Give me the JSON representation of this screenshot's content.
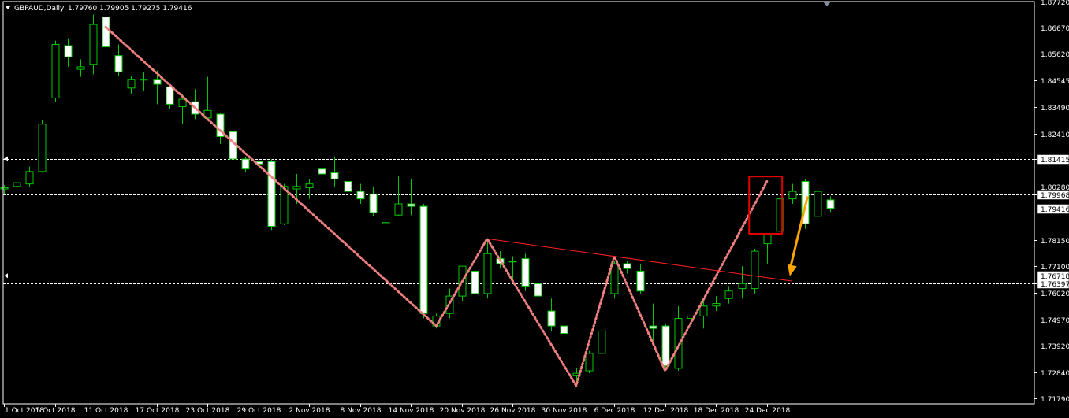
{
  "header": {
    "symbol": "GBPAUD,Daily",
    "ohlc": "1.79760 1.79905 1.79275 1.79416"
  },
  "chart_data": {
    "type": "candlestick",
    "title": "GBPAUD,Daily",
    "ylim": [
      1.717,
      1.8772
    ],
    "y_ticks": [
      "1.87720",
      "1.86670",
      "1.85620",
      "1.84545",
      "1.83490",
      "1.82410",
      "1.81415",
      "1.80280",
      "1.79968",
      "1.79416",
      "1.78150",
      "1.77100",
      "1.76718",
      "1.76397",
      "1.76020",
      "1.74970",
      "1.73920",
      "1.72840",
      "1.71790"
    ],
    "x_ticks": [
      {
        "i": 0,
        "label": "1 Oct 2018"
      },
      {
        "i": 4,
        "label": "5 Oct 2018"
      },
      {
        "i": 8,
        "label": "11 Oct 2018"
      },
      {
        "i": 12,
        "label": "17 Oct 2018"
      },
      {
        "i": 16,
        "label": "23 Oct 2018"
      },
      {
        "i": 20,
        "label": "29 Oct 2018"
      },
      {
        "i": 24,
        "label": "2 Nov 2018"
      },
      {
        "i": 28,
        "label": "8 Nov 2018"
      },
      {
        "i": 32,
        "label": "14 Nov 2018"
      },
      {
        "i": 36,
        "label": "20 Nov 2018"
      },
      {
        "i": 40,
        "label": "26 Nov 2018"
      },
      {
        "i": 44,
        "label": "30 Nov 2018"
      },
      {
        "i": 48,
        "label": "6 Dec 2018"
      },
      {
        "i": 52,
        "label": "12 Dec 2018"
      },
      {
        "i": 56,
        "label": "18 Dec 2018"
      },
      {
        "i": 60,
        "label": "24 Dec 2018"
      }
    ],
    "candles": [
      [
        1.802,
        1.8035,
        1.8,
        1.8025
      ],
      [
        1.803,
        1.806,
        1.801,
        1.8045
      ],
      [
        1.804,
        1.811,
        1.803,
        1.809
      ],
      [
        1.809,
        1.8295,
        1.8085,
        1.828
      ],
      [
        1.8385,
        1.8615,
        1.837,
        1.86
      ],
      [
        1.8595,
        1.8625,
        1.851,
        1.855
      ],
      [
        1.85,
        1.854,
        1.847,
        1.851
      ],
      [
        1.852,
        1.872,
        1.848,
        1.868
      ],
      [
        1.871,
        1.873,
        1.857,
        1.859
      ],
      [
        1.8555,
        1.86,
        1.8475,
        1.849
      ],
      [
        1.8425,
        1.8475,
        1.84,
        1.846
      ],
      [
        1.846,
        1.849,
        1.8415,
        1.846
      ],
      [
        1.846,
        1.8495,
        1.836,
        1.844
      ],
      [
        1.843,
        1.844,
        1.834,
        1.836
      ],
      [
        1.835,
        1.84,
        1.828,
        1.838
      ],
      [
        1.837,
        1.842,
        1.83,
        1.832
      ],
      [
        1.8305,
        1.847,
        1.83,
        1.8335
      ],
      [
        1.832,
        1.8325,
        1.82,
        1.823
      ],
      [
        1.825,
        1.826,
        1.81,
        1.814
      ],
      [
        1.814,
        1.815,
        1.809,
        1.81
      ],
      [
        1.813,
        1.817,
        1.805,
        1.812
      ],
      [
        1.813,
        1.814,
        1.7855,
        1.787
      ],
      [
        1.788,
        1.804,
        1.7875,
        1.803
      ],
      [
        1.802,
        1.808,
        1.796,
        1.803
      ],
      [
        1.8025,
        1.806,
        1.798,
        1.804
      ],
      [
        1.81,
        1.812,
        1.806,
        1.808
      ],
      [
        1.8085,
        1.815,
        1.803,
        1.806
      ],
      [
        1.805,
        1.814,
        1.8,
        1.801
      ],
      [
        1.801,
        1.804,
        1.796,
        1.798
      ],
      [
        1.8,
        1.803,
        1.791,
        1.7925
      ],
      [
        1.788,
        1.796,
        1.782,
        1.7885
      ],
      [
        1.7915,
        1.807,
        1.791,
        1.796
      ],
      [
        1.796,
        1.806,
        1.7915,
        1.795
      ],
      [
        1.795,
        1.796,
        1.75,
        1.752
      ],
      [
        1.747,
        1.752,
        1.746,
        1.751
      ],
      [
        1.752,
        1.762,
        1.75,
        1.759
      ],
      [
        1.759,
        1.771,
        1.757,
        1.771
      ],
      [
        1.769,
        1.772,
        1.757,
        1.76
      ],
      [
        1.76,
        1.781,
        1.758,
        1.776
      ],
      [
        1.774,
        1.777,
        1.77,
        1.772
      ],
      [
        1.773,
        1.775,
        1.765,
        1.773
      ],
      [
        1.774,
        1.776,
        1.761,
        1.763
      ],
      [
        1.764,
        1.769,
        1.755,
        1.759
      ],
      [
        1.753,
        1.758,
        1.745,
        1.747
      ],
      [
        1.747,
        1.748,
        1.743,
        1.744
      ],
      [
        1.727,
        1.73,
        1.723,
        1.728
      ],
      [
        1.729,
        1.737,
        1.728,
        1.736
      ],
      [
        1.736,
        1.747,
        1.734,
        1.745
      ],
      [
        1.76,
        1.773,
        1.758,
        1.772
      ],
      [
        1.772,
        1.773,
        1.768,
        1.77
      ],
      [
        1.769,
        1.772,
        1.76,
        1.761
      ],
      [
        1.747,
        1.756,
        1.741,
        1.746
      ],
      [
        1.747,
        1.748,
        1.73,
        1.731
      ],
      [
        1.73,
        1.755,
        1.729,
        1.75
      ],
      [
        1.75,
        1.755,
        1.746,
        1.751
      ],
      [
        1.751,
        1.757,
        1.746,
        1.755
      ],
      [
        1.755,
        1.759,
        1.753,
        1.756
      ],
      [
        1.758,
        1.763,
        1.756,
        1.761
      ],
      [
        1.762,
        1.771,
        1.758,
        1.764
      ],
      [
        1.762,
        1.778,
        1.76,
        1.777
      ],
      [
        1.78,
        1.784,
        1.772,
        1.784
      ],
      [
        1.785,
        1.8,
        1.784,
        1.798
      ],
      [
        1.798,
        1.804,
        1.796,
        1.801
      ],
      [
        1.805,
        1.806,
        1.786,
        1.788
      ],
      [
        1.791,
        1.802,
        1.787,
        1.801
      ],
      [
        1.7976,
        1.799,
        1.7927,
        1.7942
      ]
    ],
    "levels": [
      {
        "price": 1.81415,
        "label": "1.81415",
        "style": "dashed"
      },
      {
        "price": 1.79968,
        "label": "1.79968",
        "style": "dashed"
      },
      {
        "price": 1.79416,
        "label": "1.79416",
        "style": "solid"
      },
      {
        "price": 1.76718,
        "label": "1.76718",
        "style": "dashed"
      },
      {
        "price": 1.76397,
        "label": "1.76397",
        "style": "dashed"
      }
    ],
    "zigzag": [
      [
        8,
        1.867
      ],
      [
        34,
        1.747
      ],
      [
        38,
        1.782
      ],
      [
        45,
        1.723
      ],
      [
        48,
        1.775
      ],
      [
        52,
        1.729
      ],
      [
        60,
        1.805
      ]
    ],
    "trendline": [
      [
        38,
        1.782
      ],
      [
        62,
        1.765
      ]
    ],
    "arrow": [
      [
        63.2,
        1.799
      ],
      [
        61.8,
        1.767
      ]
    ],
    "highlight_box": [
      [
        58.6,
        1.807
      ],
      [
        61.2,
        1.784
      ]
    ],
    "colors": {
      "background": "#000000",
      "bull_fill": "#000000",
      "bear_fill": "#ffffff",
      "candle_outline": "#00c800",
      "zigzag": "#f08080",
      "trendline": "#ff2020",
      "arrow": "#ffa500",
      "highlight_box": "#e00000",
      "level_line": "#ffffff",
      "current_price_line": "#6f8ab8",
      "marker": "#7f8fa3"
    }
  }
}
